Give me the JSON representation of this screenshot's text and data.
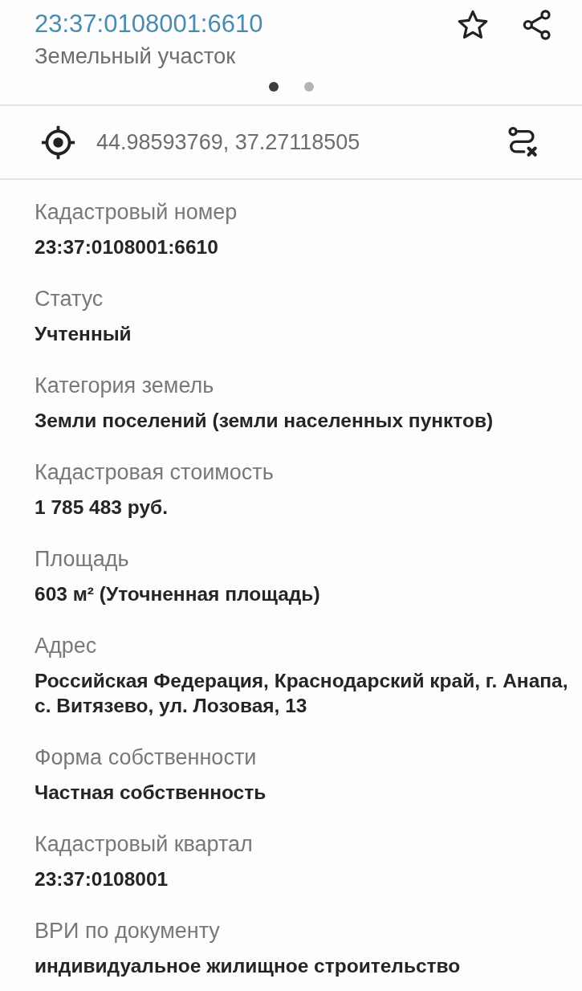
{
  "header": {
    "title": "23:37:0108001:6610",
    "subtitle": "Земельный участок",
    "pager": [
      {
        "selected": true
      },
      {
        "selected": false
      }
    ]
  },
  "location": {
    "coordinates": "44.98593769, 37.27118505"
  },
  "fields": [
    {
      "label": "Кадастровый номер",
      "value": "23:37:0108001:6610"
    },
    {
      "label": "Статус",
      "value": "Учтенный"
    },
    {
      "label": "Категория земель",
      "value": "Земли поселений (земли населенных пунктов)"
    },
    {
      "label": "Кадастровая стоимость",
      "value": "1 785 483 руб."
    },
    {
      "label": "Площадь",
      "value": "603 м² (Уточненная площадь)"
    },
    {
      "label": "Адрес",
      "value": "Российская Федерация, Краснодарский край, г. Анапа, с. Витязево, ул. Лозовая, 13"
    },
    {
      "label": "Форма собственности",
      "value": "Частная собственность"
    },
    {
      "label": "Кадастровый квартал",
      "value": "23:37:0108001"
    },
    {
      "label": "ВРИ по документу",
      "value": "индивидуальное жилищное строительство"
    }
  ]
}
